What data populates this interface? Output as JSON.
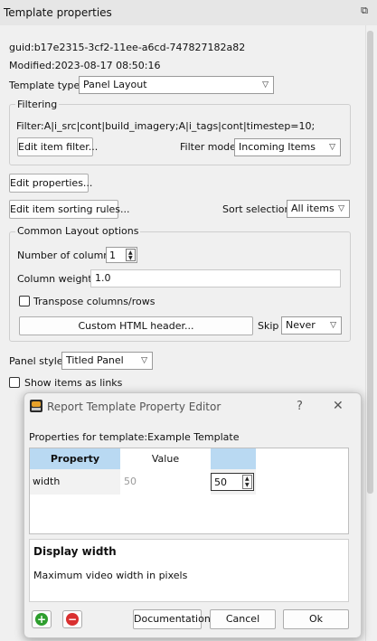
{
  "panel": {
    "title": "Template properties",
    "guid": "guid:b17e2315-3cf2-11ee-a6cd-747827182a82",
    "modified": "Modified:2023-08-17 08:50:16",
    "template_type_label": "Template type:",
    "template_type_value": "Panel Layout",
    "filtering": {
      "label": "Filtering",
      "filter_text": "Filter:A|i_src|cont|build_imagery;A|i_tags|cont|timestep=10;",
      "edit_filter_button": "Edit item filter...",
      "filter_mode_label": "Filter mode",
      "filter_mode_value": "Incoming Items"
    },
    "edit_properties_button": "Edit properties...",
    "edit_sorting_button": "Edit item sorting rules...",
    "sort_selection_label": "Sort selection",
    "sort_selection_value": "All items",
    "layout": {
      "label": "Common Layout options",
      "columns_label": "Number of columns",
      "columns_value": "1",
      "weights_label": "Column weights",
      "weights_value": "1.0",
      "transpose_label": "Transpose columns/rows",
      "transpose_checked": false,
      "html_header_button": "Custom HTML header...",
      "skip_label": "Skip",
      "skip_value": "Never"
    },
    "panel_style_label": "Panel style",
    "panel_style_value": "Titled Panel",
    "show_links_label": "Show items as links",
    "show_links_checked": false
  },
  "dialog": {
    "title": "Report Template Property Editor",
    "help_label": "?",
    "close_label": "✕",
    "properties_for": "Properties for template:Example Template",
    "columns": [
      "Property",
      "Value"
    ],
    "header_color": "#b9d9f2",
    "rows": [
      {
        "property": "width",
        "default_value": "50",
        "value": "50"
      }
    ],
    "desc_title": "Display width",
    "desc_text": "Maximum video width in pixels",
    "documentation_button": "Documentation",
    "cancel_button": "Cancel",
    "ok_button": "Ok",
    "add_color": "#2e9e2e",
    "remove_color": "#d93030"
  }
}
